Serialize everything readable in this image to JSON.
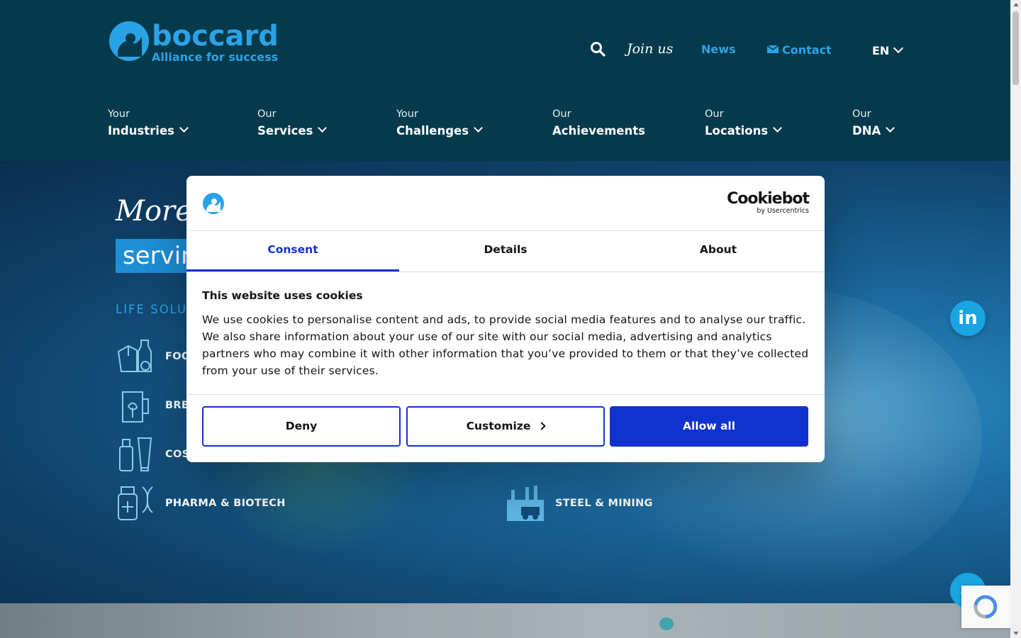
{
  "brand": {
    "name": "boccard",
    "tagline": "Alliance for success",
    "color": "#2aa3e6"
  },
  "topnav": {
    "join_us": "Join us",
    "news": "News",
    "contact": "Contact",
    "language": "EN"
  },
  "mainnav": [
    {
      "pre": "Your",
      "label": "Industries",
      "dropdown": true
    },
    {
      "pre": "Our",
      "label": "Services",
      "dropdown": true
    },
    {
      "pre": "Your",
      "label": "Challenges",
      "dropdown": true
    },
    {
      "pre": "Our",
      "label": "Achievements",
      "dropdown": false
    },
    {
      "pre": "Our",
      "label": "Locations",
      "dropdown": true
    },
    {
      "pre": "Our",
      "label": "DNA",
      "dropdown": true
    }
  ],
  "hero": {
    "title_visible": "More t",
    "highlight_visible": "servir",
    "subtitle_visible": "LIFE SOLU",
    "industries": [
      {
        "label": "FOO",
        "icon": "food-packaging-icon"
      },
      {
        "label": "BRE",
        "icon": "beer-mug-icon"
      },
      {
        "label": "COS",
        "icon": "cosmetics-bottles-icon"
      },
      {
        "label": "PHARMA & BIOTECH",
        "icon": "pharma-dna-icon"
      },
      {
        "label": "STEEL & MINING",
        "icon": "steel-factory-icon"
      }
    ]
  },
  "cookie_dialog": {
    "provider": "Cookiebot",
    "provider_sub": "by Usercentrics",
    "tabs": [
      "Consent",
      "Details",
      "About"
    ],
    "active_tab": "Consent",
    "title": "This website uses cookies",
    "text": "We use cookies to personalise content and ads, to provide social media features and to analyse our traffic. We also share information about your use of our site with our social media, advertising and analytics partners who may combine it with other information that you’ve provided to them or that they’ve collected from your use of their services.",
    "buttons": {
      "deny": "Deny",
      "customize": "Customize",
      "allow_all": "Allow all"
    },
    "accent_color": "#1032cf"
  },
  "floating": {
    "linkedin": "in"
  }
}
